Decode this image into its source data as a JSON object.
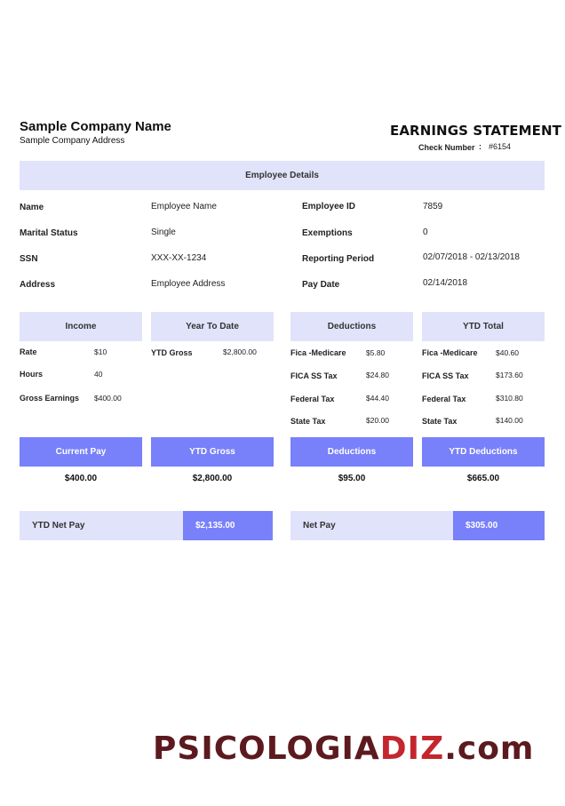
{
  "company": {
    "name": "Sample Company Name",
    "address": "Sample Company Address"
  },
  "statement": {
    "title": "EARNINGS STATEMENT",
    "check_label": "Check Number",
    "check_colon": ":",
    "check_number": "#6154"
  },
  "employee_details": {
    "header": "Employee Details",
    "left": [
      {
        "label": "Name",
        "value": "Employee Name"
      },
      {
        "label": "Marital Status",
        "value": "Single"
      },
      {
        "label": "SSN",
        "value": "XXX-XX-1234"
      },
      {
        "label": "Address",
        "value": "Employee Address"
      }
    ],
    "right": [
      {
        "label": "Employee ID",
        "value": "7859"
      },
      {
        "label": "Exemptions",
        "value": "0"
      },
      {
        "label": "Reporting Period",
        "value": "02/07/2018 - 02/13/2018"
      },
      {
        "label": "Pay Date",
        "value": "02/14/2018"
      }
    ]
  },
  "columns": {
    "income": {
      "header": "Income",
      "items": [
        {
          "label": "Rate",
          "value": "$10"
        },
        {
          "label": "Hours",
          "value": "40"
        },
        {
          "label": "Gross Earnings",
          "value": "$400.00"
        }
      ]
    },
    "ytd": {
      "header": "Year To Date",
      "items": [
        {
          "label": "YTD Gross",
          "value": "$2,800.00"
        }
      ]
    },
    "deductions": {
      "header": "Deductions",
      "items": [
        {
          "label": "Fica -Medicare",
          "value": "$5.80"
        },
        {
          "label": "FICA SS Tax",
          "value": "$24.80"
        },
        {
          "label": "Federal Tax",
          "value": "$44.40"
        },
        {
          "label": "State Tax",
          "value": "$20.00"
        }
      ]
    },
    "ytd_total": {
      "header": "YTD Total",
      "items": [
        {
          "label": "Fica -Medicare",
          "value": "$40.60"
        },
        {
          "label": "FICA SS Tax",
          "value": "$173.60"
        },
        {
          "label": "Federal Tax",
          "value": "$310.80"
        },
        {
          "label": "State Tax",
          "value": "$140.00"
        }
      ]
    }
  },
  "summary": [
    {
      "label": "Current Pay",
      "value": "$400.00"
    },
    {
      "label": "YTD Gross",
      "value": "$2,800.00"
    },
    {
      "label": "Deductions",
      "value": "$95.00"
    },
    {
      "label": "YTD Deductions",
      "value": "$665.00"
    }
  ],
  "net": {
    "ytd_label": "YTD Net Pay",
    "ytd_value": "$2,135.00",
    "net_label": "Net Pay",
    "net_value": "$305.00"
  },
  "watermark": {
    "part1": "PSICOLOGIA",
    "part2": "DIZ",
    "part3": ".com"
  },
  "colors": {
    "light_band": "#e1e3fb",
    "dark_band": "#7880fa"
  }
}
